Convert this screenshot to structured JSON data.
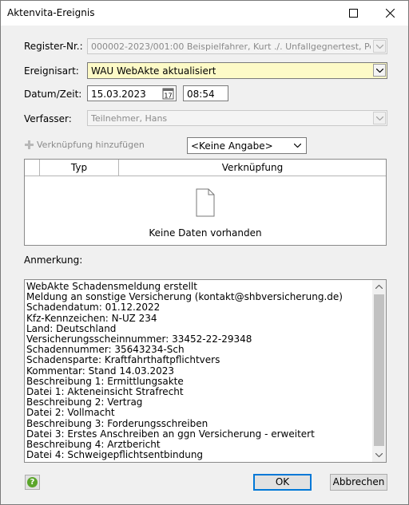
{
  "window": {
    "title": "Aktenvita-Ereignis"
  },
  "form": {
    "register_label": "Register-Nr.:",
    "register_value": "000002-2023/001:00  Beispielfahrer, Kurt ./. Unfallgegnertest, Petra",
    "ereignisart_label": "Ereignisart:",
    "ereignisart_value": "WAU  WebAkte aktualisiert",
    "datum_label": "Datum/Zeit:",
    "datum_value": "15.03.2023",
    "zeit_value": "08:54",
    "verfasser_label": "Verfasser:",
    "verfasser_value": "Teilnehmer, Hans"
  },
  "links": {
    "add_label": "Verknüpfung hinzufügen",
    "filter_value": "<Keine Angabe>",
    "columns": [
      "Typ",
      "Verknüpfung"
    ],
    "empty_text": "Keine Daten vorhanden"
  },
  "remark": {
    "label": "Anmerkung:",
    "lines": [
      "WebAkte Schadensmeldung erstellt",
      "Meldung an sonstige Versicherung (kontakt@shbversicherung.de)",
      "Schadendatum: 01.12.2022",
      "Kfz-Kennzeichen: N-UZ 234",
      "Land: Deutschland",
      "Versicherungsscheinnummer: 33452-22-29348",
      "Schadennummer: 35643234-Sch",
      "Schadensparte: Kraftfahrthaftpflichtvers",
      "Kommentar: Stand 14.03.2023",
      "Beschreibung 1: Ermittlungsakte",
      "Datei 1: Akteneinsicht Strafrecht",
      "Beschreibung 2: Vertrag",
      "Datei 2: Vollmacht",
      "Beschreibung 3: Forderungsschreiben",
      "Datei 3: Erstes Anschreiben an ggn Versicherung - erweitert",
      "Beschreibung 4: Arztbericht",
      "Datei 4: Schweigepflichtsentbindung"
    ]
  },
  "buttons": {
    "help_glyph": "?",
    "ok_label": "OK",
    "cancel_label": "Abbrechen"
  },
  "colors": {
    "ereignisart_bg": "#fdfac7",
    "default_button_border": "#0078d7",
    "help_icon": "#5aa52a"
  }
}
